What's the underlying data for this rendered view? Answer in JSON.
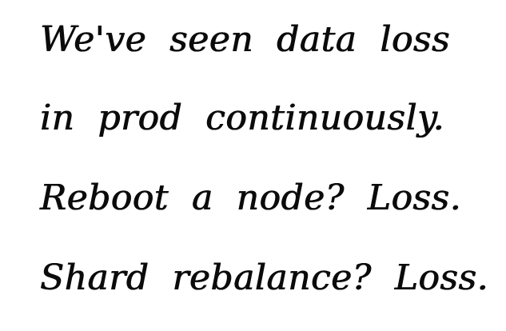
{
  "lines": [
    "We've  seen  data  loss",
    "in  prod  continuously.",
    "Reboot  a  node?  Loss.",
    "Shard  rebalance?  Loss."
  ]
}
